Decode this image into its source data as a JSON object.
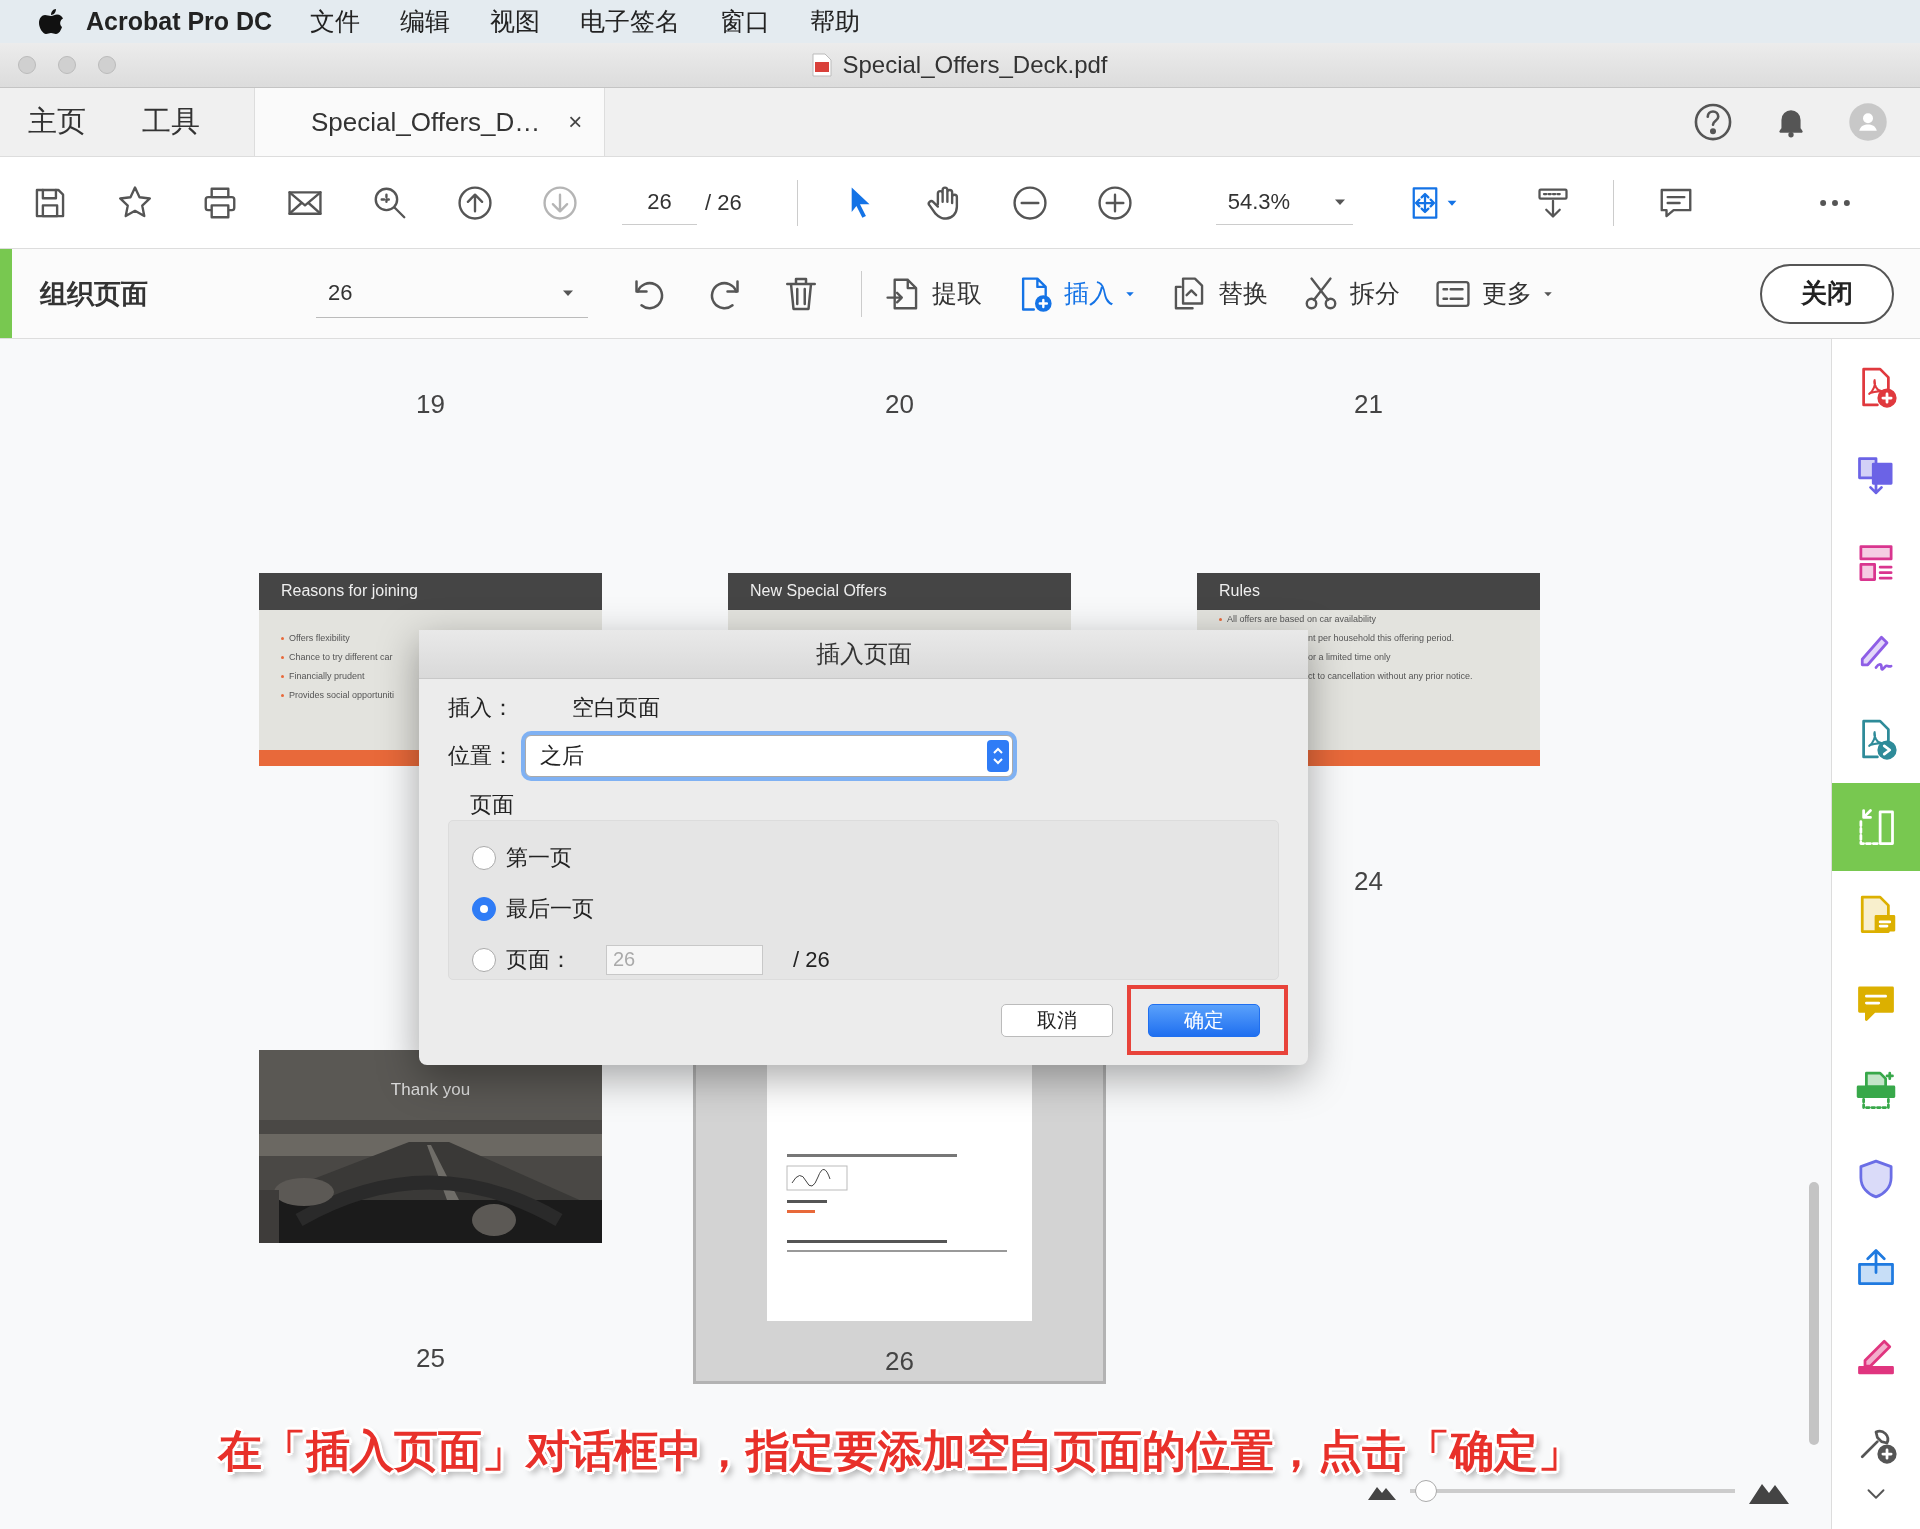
{
  "menubar": {
    "app": "Acrobat Pro DC",
    "menus": [
      "文件",
      "编辑",
      "视图",
      "电子签名",
      "窗口",
      "帮助"
    ]
  },
  "window": {
    "title": "Special_Offers_Deck.pdf"
  },
  "tabs": [
    {
      "label": "主页",
      "kind": "nav",
      "selected": false
    },
    {
      "label": "工具",
      "kind": "nav",
      "selected": false
    },
    {
      "label": "Special_Offers_D…",
      "kind": "document",
      "selected": true,
      "close": "×"
    }
  ],
  "toolbar": {
    "file_tools": [
      {
        "kind": "save",
        "disabled": false
      },
      {
        "kind": "star",
        "disabled": false
      },
      {
        "kind": "print",
        "disabled": false
      },
      {
        "kind": "mail",
        "disabled": false
      },
      {
        "kind": "zoomsearch",
        "disabled": false
      },
      {
        "kind": "up",
        "disabled": false
      },
      {
        "kind": "down",
        "disabled": true
      }
    ],
    "page_value": "26",
    "page_total": "/ 26",
    "nav_tools": [
      {
        "kind": "pointer",
        "selected": true
      },
      {
        "kind": "hand",
        "selected": false
      },
      {
        "kind": "zoomout",
        "selected": false
      },
      {
        "kind": "zoomin",
        "selected": false
      }
    ],
    "zoom_value": "54.3%",
    "view_tools": [
      {
        "kind": "fit",
        "menu": true
      },
      {
        "kind": "scroll",
        "menu": false
      }
    ],
    "end_tools": [
      {
        "kind": "comment"
      },
      {
        "kind": "more"
      }
    ]
  },
  "organize": {
    "title": "组织页面",
    "page_select": "26",
    "actions": [
      {
        "kind": "undo"
      },
      {
        "kind": "redo"
      },
      {
        "kind": "delete"
      }
    ],
    "commands": [
      {
        "kind": "extract",
        "label": "提取",
        "menu": false,
        "active": false
      },
      {
        "kind": "insert",
        "label": "插入",
        "menu": true,
        "active": true
      },
      {
        "kind": "replace",
        "label": "替换",
        "menu": false,
        "active": false
      },
      {
        "kind": "split",
        "label": "拆分",
        "menu": false,
        "active": false
      },
      {
        "kind": "morelist",
        "label": "更多",
        "menu": true,
        "active": false
      }
    ],
    "close": "关闭"
  },
  "pages": [
    {
      "number": "19",
      "selected": false
    },
    {
      "number": "20",
      "selected": false
    },
    {
      "number": "21",
      "selected": false
    },
    {
      "selected": false,
      "slide": {
        "kind": "bullets",
        "title": "Reasons for joining",
        "first_line_hidden": true,
        "bullets": [
          {
            "text": "Offers flexibility",
            "cut": false
          },
          {
            "text": "Chance to try different car",
            "cut": false
          },
          {
            "text": "Financially prudent",
            "cut": false
          },
          {
            "text": "Provides social opportuniti",
            "cut": false
          }
        ]
      }
    },
    {
      "selected": false,
      "slide": {
        "kind": "bullets",
        "title": "New Special Offers"
      }
    },
    {
      "number": "24",
      "selected": false,
      "slide": {
        "kind": "bullets",
        "title": "Rules",
        "first_line_hidden": false,
        "bullets": [
          {
            "text": "All offers are based on car availability",
            "cut": false
          },
          {
            "text": "nt per household this offering period.",
            "cut": true
          },
          {
            "text": "or a limited time only",
            "cut": true
          },
          {
            "text": "ct to cancellation without any prior notice.",
            "cut": true
          }
        ]
      }
    },
    {
      "number": "25",
      "selected": false,
      "slide": {
        "title": "Thank you"
      }
    },
    {
      "number": "26",
      "selected": true,
      "slide": {
        "kind": "document"
      }
    }
  ],
  "dialog": {
    "title": "插入页面",
    "insert_label": "插入：",
    "insert_value": "空白页面",
    "position_label": "位置：",
    "position_value": "之后",
    "group_label": "页面",
    "options": [
      {
        "label": "第一页",
        "kind": "plain",
        "selected": false
      },
      {
        "label": "最后一页",
        "kind": "plain",
        "selected": true
      },
      {
        "label": "页面：",
        "kind": "page",
        "selected": false
      }
    ],
    "page_field": {
      "value": "26",
      "disabled": true
    },
    "page_total": "/ 26",
    "buttons": [
      {
        "label": "取消",
        "default": false,
        "highlighted": false
      },
      {
        "label": "确定",
        "default": true,
        "highlighted": true
      }
    ]
  },
  "sidebar": {
    "tools": [
      {
        "kind": "pdfadd",
        "selected": false
      },
      {
        "kind": "docsarrow",
        "selected": false
      },
      {
        "kind": "layout",
        "selected": false
      },
      {
        "kind": "sign",
        "selected": false
      },
      {
        "kind": "pdfsend",
        "selected": false
      },
      {
        "kind": "organize",
        "selected": true
      },
      {
        "kind": "notes",
        "selected": false
      },
      {
        "kind": "comment2",
        "selected": false
      },
      {
        "kind": "scan",
        "selected": false
      },
      {
        "kind": "protect",
        "selected": false
      },
      {
        "kind": "share",
        "selected": false
      },
      {
        "kind": "redact",
        "selected": false
      },
      {
        "kind": "tools",
        "selected": false
      }
    ]
  },
  "zoom_slider": {
    "level": 0.05
  },
  "caption": "在「插入页面」对话框中，指定要添加空白页面的位置，点击「确定」"
}
